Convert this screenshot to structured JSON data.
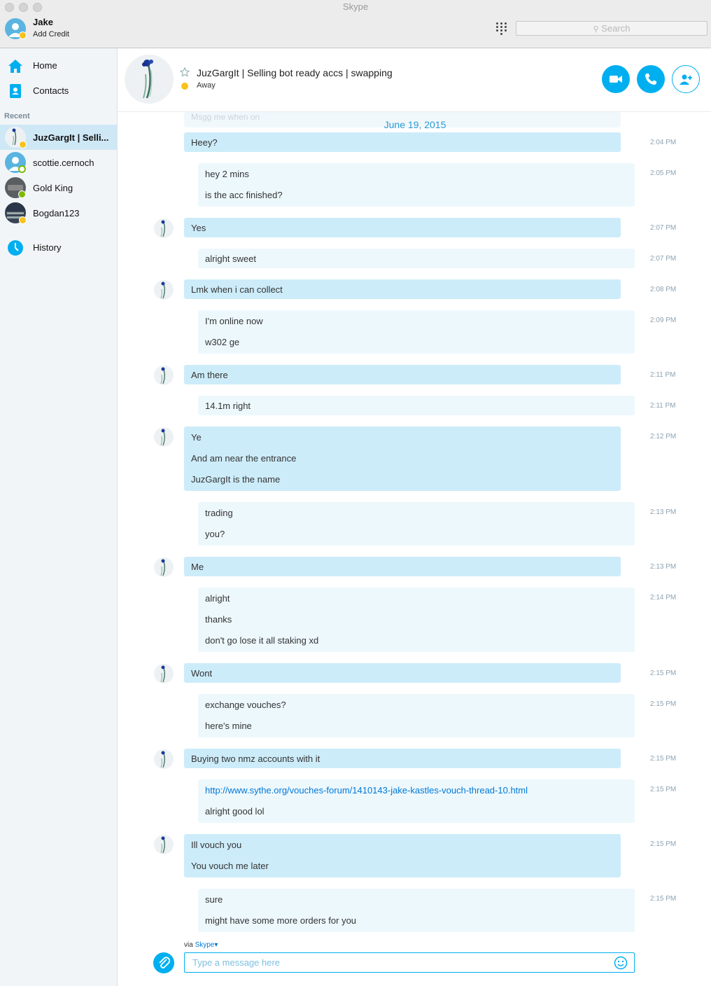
{
  "app_title": "Skype",
  "profile": {
    "name": "Jake",
    "subtitle": "Add Credit"
  },
  "search_placeholder": "Search",
  "sidebar": {
    "home": "Home",
    "contacts": "Contacts",
    "recent_header": "Recent",
    "recent": [
      {
        "label": "JuzGargIt | Selli...",
        "status": "away",
        "selected": true
      },
      {
        "label": "scottie.cernoch",
        "status": "online"
      },
      {
        "label": "Gold King",
        "status": "online"
      },
      {
        "label": "Bogdan123",
        "status": "away"
      }
    ],
    "history": "History"
  },
  "chat": {
    "title": "JuzGargIt | Selling bot ready accs | swapping",
    "status": "Away",
    "date": "June 19, 2015",
    "ghost_text": "Msgg me when on",
    "messages": [
      {
        "from": "them",
        "lines": [
          "Heey?"
        ],
        "time": "2:04 PM"
      },
      {
        "from": "me",
        "lines": [
          "hey 2 mins",
          "is the acc finished?"
        ],
        "time": "2:05 PM"
      },
      {
        "from": "them",
        "lines": [
          "Yes"
        ],
        "time": "2:07 PM"
      },
      {
        "from": "me",
        "lines": [
          "alright sweet"
        ],
        "time": "2:07 PM"
      },
      {
        "from": "them",
        "lines": [
          "Lmk when i can collect"
        ],
        "time": "2:08 PM"
      },
      {
        "from": "me",
        "lines": [
          "I'm online now",
          "w302 ge"
        ],
        "time": "2:09 PM"
      },
      {
        "from": "them",
        "lines": [
          "Am there"
        ],
        "time": "2:11 PM"
      },
      {
        "from": "me",
        "lines": [
          "14.1m right"
        ],
        "time": "2:11 PM"
      },
      {
        "from": "them",
        "lines": [
          "Ye",
          "And am near the entrance",
          "JuzGargIt is the name"
        ],
        "time": "2:12 PM"
      },
      {
        "from": "me",
        "lines": [
          "trading",
          "you?"
        ],
        "time": "2:13 PM"
      },
      {
        "from": "them",
        "lines": [
          "Me"
        ],
        "time": "2:13 PM"
      },
      {
        "from": "me",
        "lines": [
          "alright",
          "thanks",
          "don't go lose it all staking xd"
        ],
        "time": "2:14 PM"
      },
      {
        "from": "them",
        "lines": [
          "Wont"
        ],
        "time": "2:15 PM"
      },
      {
        "from": "me",
        "lines": [
          "exchange vouches?",
          "here's mine"
        ],
        "time": "2:15 PM"
      },
      {
        "from": "them",
        "lines": [
          "Buying two nmz accounts with it"
        ],
        "time": "2:15 PM"
      },
      {
        "from": "me",
        "lines": [
          "http://www.sythe.org/vouches-forum/1410143-jake-kastles-vouch-thread-10.html",
          "alright good lol"
        ],
        "link_first": true,
        "time": "2:15 PM"
      },
      {
        "from": "them",
        "lines": [
          "Ill vouch you",
          "You vouch me later"
        ],
        "time": "2:15 PM"
      },
      {
        "from": "me",
        "lines": [
          "sure",
          "might have some more orders for you"
        ],
        "time": "2:15 PM"
      }
    ]
  },
  "composer": {
    "via_prefix": "via",
    "via_link": "Skype",
    "placeholder": "Type a message here"
  },
  "colors": {
    "accent": "#00aff0",
    "their_bubble": "#cdecfa",
    "my_bubble": "#edf8fd",
    "away": "#f8c21c",
    "online": "#7fba00"
  }
}
